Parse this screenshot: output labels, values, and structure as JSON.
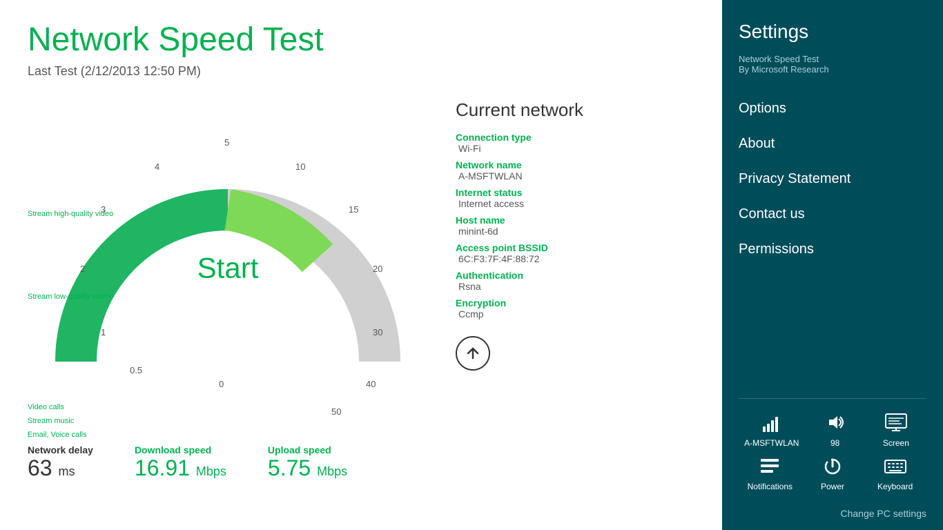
{
  "app": {
    "title": "Network Speed Test",
    "lastTest": "Last Test (2/12/2013 12:50 PM)"
  },
  "gauge": {
    "startLabel": "Start",
    "numbers": [
      "0",
      "0.5",
      "1",
      "2",
      "3",
      "4",
      "5",
      "10",
      "15",
      "20",
      "30",
      "40",
      "50"
    ],
    "activities": [
      {
        "label": "Stream high-quality video",
        "pos": "left-upper"
      },
      {
        "label": "Stream low-quality video",
        "pos": "left-mid"
      },
      {
        "label": "Video calls",
        "pos": "left-lower1"
      },
      {
        "label": "Stream music",
        "pos": "left-lower2"
      },
      {
        "label": "Email, Voice calls",
        "pos": "left-lower3"
      }
    ]
  },
  "network": {
    "title": "Current network",
    "fields": [
      {
        "label": "Connection type",
        "value": "Wi-Fi"
      },
      {
        "label": "Network name",
        "value": "A-MSFTWLAN"
      },
      {
        "label": "Internet status",
        "value": "Internet access"
      },
      {
        "label": "Host name",
        "value": "minint-6d"
      },
      {
        "label": "Access point BSSID",
        "value": "6C:F3:7F:4F:88:72"
      },
      {
        "label": "Authentication",
        "value": "Rsna"
      },
      {
        "label": "Encryption",
        "value": "Ccmp"
      }
    ]
  },
  "stats": {
    "delay": {
      "label": "Network delay",
      "value": "63",
      "unit": "ms"
    },
    "download": {
      "label": "Download speed",
      "value": "16.91",
      "unit": "Mbps"
    },
    "upload": {
      "label": "Upload speed",
      "value": "5.75",
      "unit": "Mbps"
    }
  },
  "sidebar": {
    "title": "Settings",
    "appName": "Network Speed Test",
    "appBy": "By Microsoft Research",
    "navItems": [
      {
        "label": "Options",
        "id": "options"
      },
      {
        "label": "About",
        "id": "about"
      },
      {
        "label": "Privacy Statement",
        "id": "privacy"
      },
      {
        "label": "Contact us",
        "id": "contact"
      },
      {
        "label": "Permissions",
        "id": "permissions"
      }
    ]
  },
  "tray": {
    "row1": [
      {
        "icon": "wifi",
        "label": "A-MSFTWLAN"
      },
      {
        "icon": "volume",
        "label": "98"
      },
      {
        "icon": "screen",
        "label": "Screen"
      }
    ],
    "row2": [
      {
        "icon": "notifications",
        "label": "Notifications"
      },
      {
        "icon": "power",
        "label": "Power"
      },
      {
        "icon": "keyboard",
        "label": "Keyboard"
      }
    ],
    "changeLabel": "Change PC settings"
  }
}
